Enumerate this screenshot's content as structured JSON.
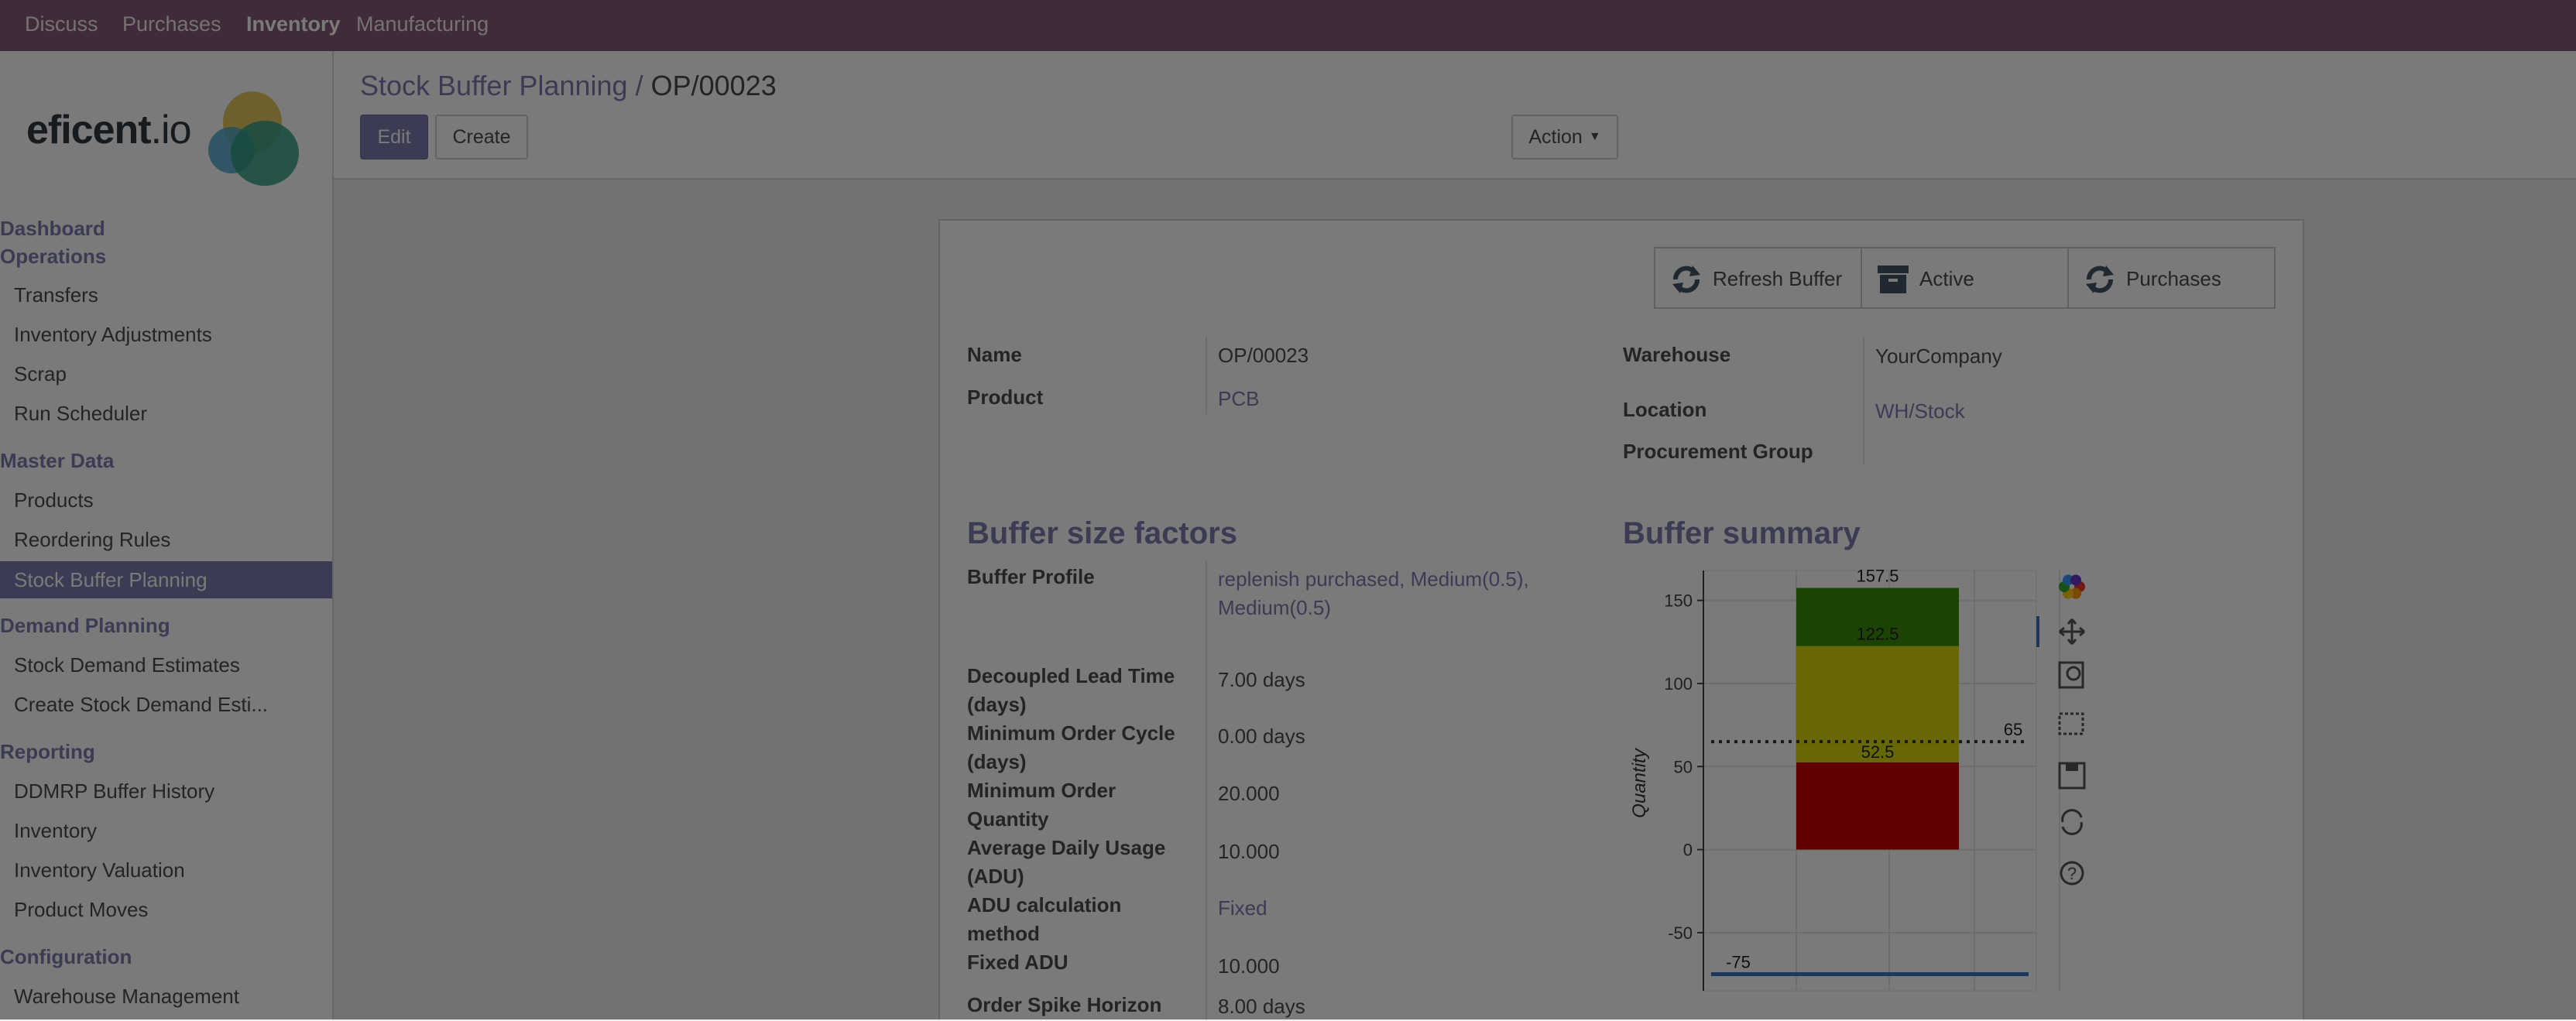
{
  "topnav": [
    "Discuss",
    "Purchases",
    "Inventory",
    "Manufacturing"
  ],
  "topnav_active": "Inventory",
  "logo": {
    "text": "eficent",
    "suffix": ".io"
  },
  "sidebar": {
    "dashboard": "Dashboard",
    "operations": "Operations",
    "operations_items": [
      "Transfers",
      "Inventory Adjustments",
      "Scrap",
      "Run Scheduler"
    ],
    "master_data": "Master Data",
    "master_data_items": [
      "Products",
      "Reordering Rules",
      "Stock Buffer Planning"
    ],
    "demand_planning": "Demand Planning",
    "demand_planning_items": [
      "Stock Demand Estimates",
      "Create Stock Demand Esti..."
    ],
    "reporting": "Reporting",
    "reporting_items": [
      "DDMRP Buffer History",
      "Inventory",
      "Inventory Valuation",
      "Product Moves"
    ],
    "configuration": "Configuration",
    "configuration_items": [
      "Warehouse Management"
    ]
  },
  "breadcrumb": {
    "parent": "Stock Buffer Planning",
    "sep": "/",
    "current": "OP/00023"
  },
  "buttons": {
    "edit": "Edit",
    "create": "Create",
    "action": "Action"
  },
  "stat_buttons": {
    "refresh": "Refresh Buffer",
    "active": "Active",
    "purchases": "Purchases"
  },
  "fields_left": [
    {
      "label": "Name",
      "value": "OP/00023"
    },
    {
      "label": "Product",
      "value": "PCB"
    }
  ],
  "fields_right": [
    {
      "label": "Warehouse",
      "value": "YourCompany"
    },
    {
      "label": "Location",
      "value": "WH/Stock"
    },
    {
      "label": "Procurement Group",
      "value": ""
    }
  ],
  "buffer_size": {
    "title": "Buffer size factors",
    "profile_label": "Buffer Profile",
    "profile_value_1": "replenish purchased, Medium(0.5),",
    "profile_value_2": "Medium(0.5)",
    "dlt_label_1": "Decoupled Lead Time",
    "dlt_label_2": "(days)",
    "dlt_value": "7.00 days",
    "moc_label_1": "Minimum Order Cycle",
    "moc_label_2": "(days)",
    "moc_value": "0.00 days",
    "moq_label_1": "Minimum Order",
    "moq_label_2": "Quantity",
    "moq_value": "20.000",
    "adu_label_1": "Average Daily Usage",
    "adu_label_2": "(ADU)",
    "adu_value": "10.000",
    "adum_label_1": "ADU calculation",
    "adum_label_2": "method",
    "adum_value": "Fixed",
    "fadu_label": "Fixed ADU",
    "fadu_value": "10.000",
    "osh_label": "Order Spike Horizon",
    "osh_value": "8.00 days"
  },
  "buffer_summary": {
    "title": "Buffer summary"
  },
  "chart_data": {
    "type": "bar",
    "ylabel": "Quantity",
    "xlabel": "",
    "ylim": [
      -85,
      168
    ],
    "yticks": [
      150,
      100,
      50,
      0,
      -50
    ],
    "zones": [
      {
        "name": "red",
        "from": 0,
        "to": 52.5,
        "color": "#cc0000"
      },
      {
        "name": "yellow",
        "from": 52.5,
        "to": 122.5,
        "color": "#d8d80c"
      },
      {
        "name": "green",
        "from": 122.5,
        "to": 157.5,
        "color": "#3c8c08"
      }
    ],
    "labels": {
      "top": "157.5",
      "mid": "122.5",
      "red": "52.5",
      "onhand": "65",
      "net": "-75"
    },
    "onhand_line": 65,
    "net_flow_line": -75,
    "grid": true
  },
  "toolbar_icons": [
    "bokeh-logo-icon",
    "pan-icon",
    "zoom-icon",
    "box-select-icon",
    "save-icon",
    "reset-icon",
    "help-icon"
  ]
}
